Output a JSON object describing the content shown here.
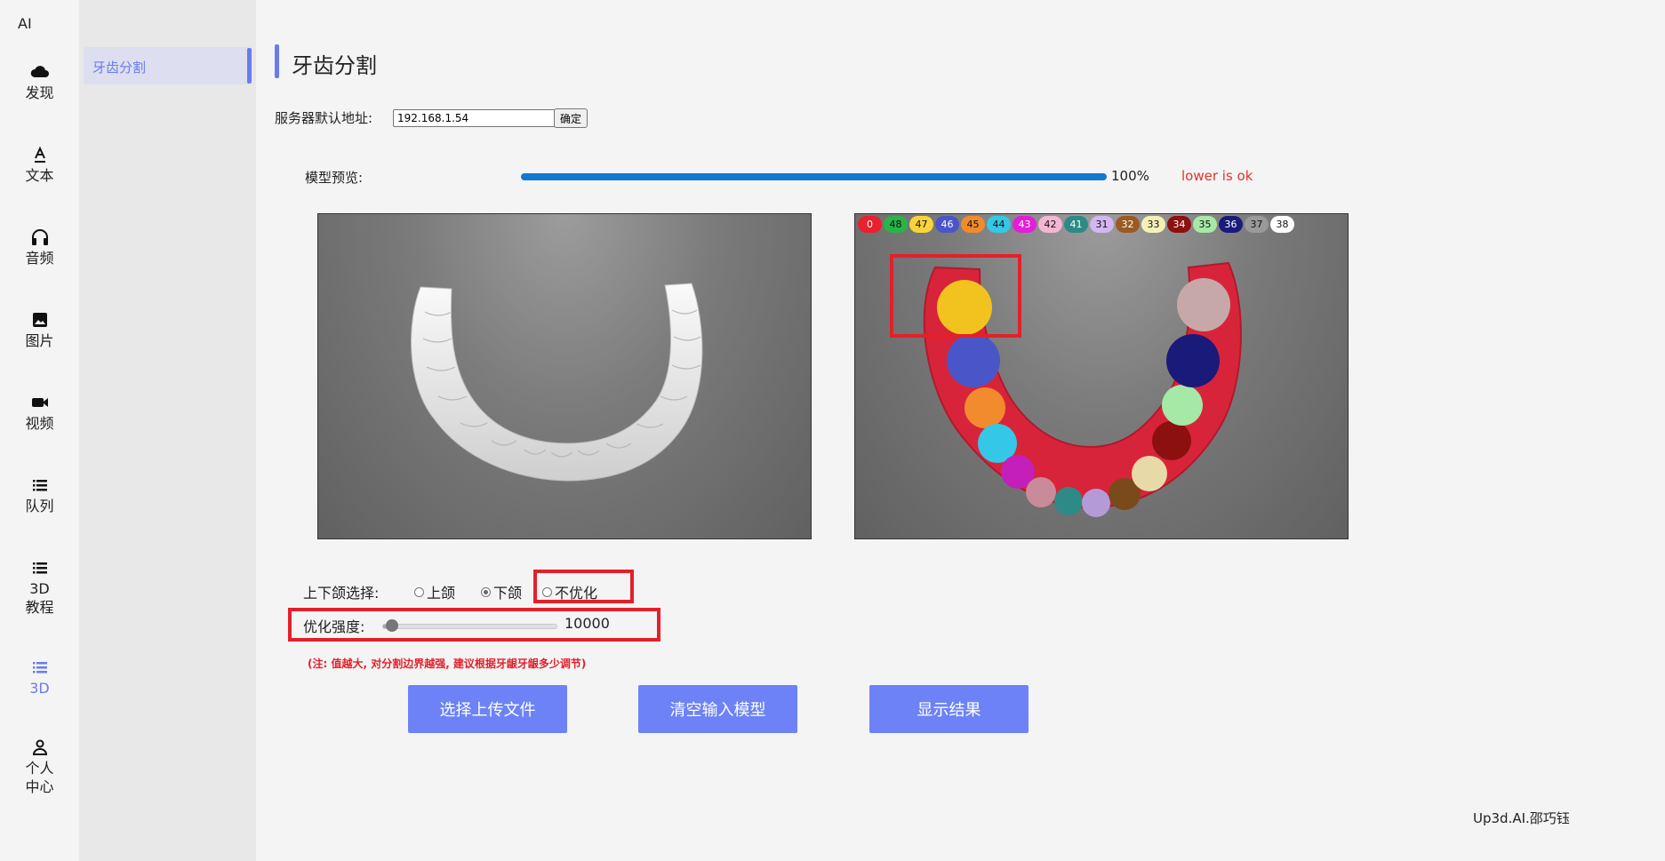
{
  "app": {
    "brand": "AI"
  },
  "nav": {
    "items": [
      {
        "label": "发现",
        "icon": "cloud-icon"
      },
      {
        "label": "文本",
        "icon": "text-icon"
      },
      {
        "label": "音频",
        "icon": "headphones-icon"
      },
      {
        "label": "图片",
        "icon": "image-icon"
      },
      {
        "label": "视频",
        "icon": "video-icon"
      },
      {
        "label": "队列",
        "icon": "list-icon"
      },
      {
        "label_lines": [
          "3D",
          "教程"
        ],
        "icon": "list-icon"
      },
      {
        "label": "3D",
        "icon": "list-icon",
        "active": true
      },
      {
        "label_lines": [
          "个人",
          "中心"
        ],
        "icon": "user-icon"
      }
    ]
  },
  "submenu": {
    "active_item": "牙齿分割"
  },
  "page": {
    "title": "牙齿分割"
  },
  "server": {
    "label": "服务器默认地址:",
    "value": "192.168.1.54",
    "confirm": "确定"
  },
  "preview": {
    "label": "模型预览:",
    "progress_percent": 100,
    "progress_text": "100%",
    "status": "lower is ok"
  },
  "legend": [
    {
      "label": "0",
      "color": "#e8212f"
    },
    {
      "label": "48",
      "color": "#2bb34a"
    },
    {
      "label": "47",
      "color": "#f7d43a"
    },
    {
      "label": "46",
      "color": "#4a56c8"
    },
    {
      "label": "45",
      "color": "#f28a2e"
    },
    {
      "label": "44",
      "color": "#35c7e6"
    },
    {
      "label": "43",
      "color": "#e21fd6"
    },
    {
      "label": "42",
      "color": "#f4b7d3"
    },
    {
      "label": "41",
      "color": "#2d8a86"
    },
    {
      "label": "31",
      "color": "#d4b6f0"
    },
    {
      "label": "32",
      "color": "#9a5b22"
    },
    {
      "label": "33",
      "color": "#f6f0b8"
    },
    {
      "label": "34",
      "color": "#8c1010"
    },
    {
      "label": "35",
      "color": "#a6e8a6"
    },
    {
      "label": "36",
      "color": "#1a1a7a"
    },
    {
      "label": "37",
      "color": "#9a9a9a"
    },
    {
      "label": "38",
      "color": "#ffffff"
    }
  ],
  "jaw": {
    "label": "上下颌选择:",
    "upper": "上颌",
    "lower": "下颌",
    "none": "不优化",
    "selected": "lower"
  },
  "strength": {
    "label": "优化强度:",
    "value": "10000",
    "level_fraction": 0.05
  },
  "note": "(注: 值越大, 对分割边界越强, 建议根据牙龈牙龈多少调节)",
  "actions": {
    "upload": "选择上传文件",
    "clear": "清空输入模型",
    "show": "显示结果"
  },
  "footer": "Up3d.AI.邵巧钰"
}
